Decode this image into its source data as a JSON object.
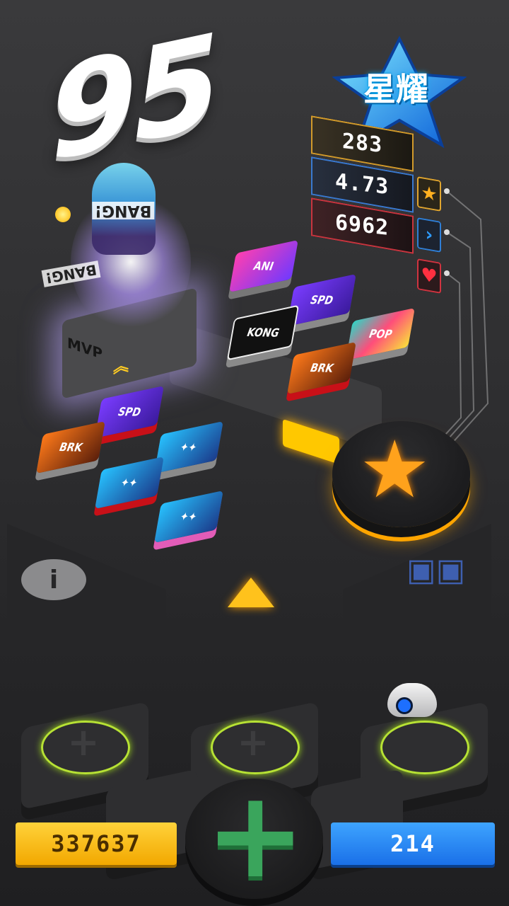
{
  "player": {
    "level": "95",
    "rank": "星耀"
  },
  "stats": [
    {
      "value": "283",
      "icon": "star-icon",
      "color": "#ffb020"
    },
    {
      "value": "4.73",
      "icon": "chevron-right-icon",
      "color": "#2f9cff"
    },
    {
      "value": "6962",
      "icon": "heart-icon",
      "color": "#ff3040"
    }
  ],
  "mvp": {
    "label": "MVP",
    "bang": "BANG!"
  },
  "tiles_top": [
    {
      "label": "ANI",
      "icon": "ani-tile-icon"
    },
    {
      "label": "SPD",
      "icon": "spd-tile-icon"
    },
    {
      "label": "KONG",
      "icon": "kong-tile-icon"
    },
    {
      "label": "POP",
      "icon": "pop-tile-icon"
    },
    {
      "label": "BRK",
      "icon": "break-tile-icon"
    }
  ],
  "tiles_left": [
    {
      "label": "SPD",
      "icon": "spd-tile-icon"
    },
    {
      "label": "BRK",
      "icon": "break-tile-icon"
    },
    {
      "label": "✦✦",
      "icon": "sparkle-tile-icon"
    },
    {
      "label": "✦✦",
      "icon": "sparkle-tile-icon"
    },
    {
      "label": "✦✦",
      "icon": "sparkle-tile-icon"
    }
  ],
  "currency": {
    "coins": "337637",
    "gems": "214"
  },
  "colors": {
    "gold": "#ffc21c",
    "blue": "#1f70e8",
    "green": "#3aa55c",
    "ring": "#b7e234"
  }
}
